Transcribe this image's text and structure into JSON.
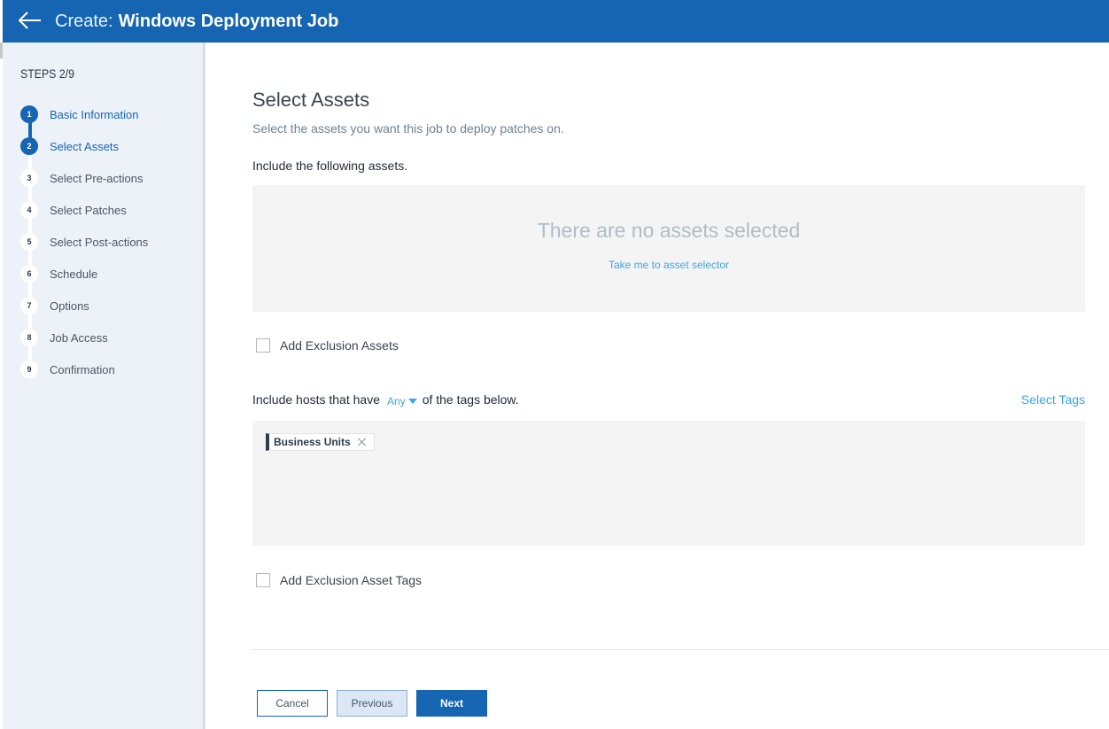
{
  "header": {
    "title_prefix": "Create:",
    "title_name": "Windows Deployment Job",
    "back_icon": "arrow-left-icon"
  },
  "sidebar": {
    "steps_header": "STEPS 2/9",
    "current_step": 2,
    "total_steps": 9,
    "steps": [
      {
        "number": "1",
        "label": "Basic Information",
        "state": "completed"
      },
      {
        "number": "2",
        "label": "Select Assets",
        "state": "active"
      },
      {
        "number": "3",
        "label": "Select Pre-actions",
        "state": "pending"
      },
      {
        "number": "4",
        "label": "Select Patches",
        "state": "pending"
      },
      {
        "number": "5",
        "label": "Select Post-actions",
        "state": "pending"
      },
      {
        "number": "6",
        "label": "Schedule",
        "state": "pending"
      },
      {
        "number": "7",
        "label": "Options",
        "state": "pending"
      },
      {
        "number": "8",
        "label": "Job Access",
        "state": "pending"
      },
      {
        "number": "9",
        "label": "Confirmation",
        "state": "pending"
      }
    ]
  },
  "main": {
    "title": "Select Assets",
    "subtitle": "Select the assets you want this job to deploy patches on.",
    "include_label": "Include the following assets.",
    "assets_empty_message": "There are no assets selected",
    "asset_selector_link": "Take me to asset selector",
    "exclusion_assets_label": "Add Exclusion Assets",
    "exclusion_assets_checked": false,
    "tags_sentence_before": "Include hosts that have",
    "tags_match_option": "Any",
    "tags_sentence_after": "of the tags below.",
    "select_tags_link": "Select Tags",
    "tags": [
      {
        "label": "Business Units"
      }
    ],
    "exclusion_tags_label": "Add Exclusion Asset Tags",
    "exclusion_tags_checked": false
  },
  "footer": {
    "cancel_label": "Cancel",
    "previous_label": "Previous",
    "next_label": "Next"
  },
  "colors": {
    "brand": "#1565b3",
    "link": "#3aa5e8",
    "sidebar_bg": "#edf2f9",
    "panel_bg": "#f4f4f4"
  }
}
